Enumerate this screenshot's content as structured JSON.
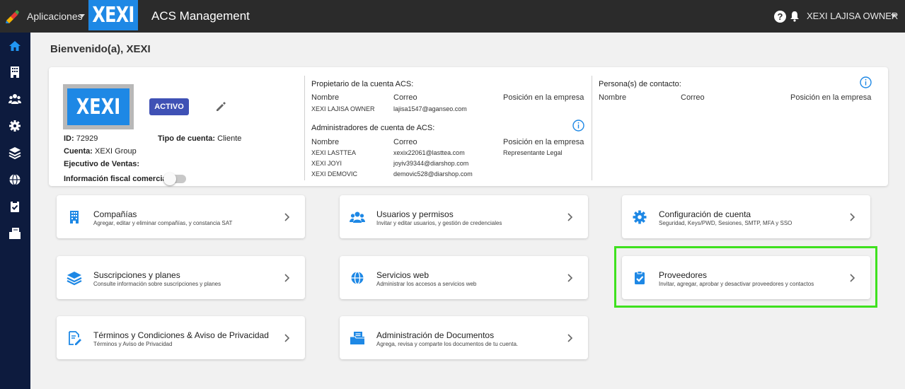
{
  "topbar": {
    "apps_label": "Aplicaciones",
    "logo_text": "XEXI",
    "app_title": "ACS Management",
    "help_label": "?",
    "user_label": "XEXI LAJISA OWNER"
  },
  "sidebar": {
    "items": [
      {
        "name": "home-icon",
        "active": true
      },
      {
        "name": "building-icon"
      },
      {
        "name": "users-icon"
      },
      {
        "name": "gear-icon"
      },
      {
        "name": "layers-icon"
      },
      {
        "name": "globe-icon"
      },
      {
        "name": "clipboard-check-icon"
      },
      {
        "name": "documents-icon"
      }
    ]
  },
  "welcome": "Bienvenido(a), XEXI",
  "account": {
    "logo_text": "XEXI",
    "status": "ACTIVO",
    "id_label": "ID:",
    "id_value": "72929",
    "tipo_label": "Tipo de cuenta:",
    "tipo_value": "Cliente",
    "cuenta_label": "Cuenta:",
    "cuenta_value": "XEXI Group",
    "ejecutivo_label": "Ejecutivo de Ventas:",
    "fiscal_label": "Información fiscal comercial:",
    "owner_section": {
      "title": "Propietario de la cuenta ACS:",
      "headers": [
        "Nombre",
        "Correo",
        "Posición en la empresa"
      ],
      "rows": [
        {
          "nombre": "XEXI LAJISA OWNER",
          "correo": "lajisa1547@aganseo.com",
          "posicion": ""
        }
      ]
    },
    "admins_section": {
      "title": "Administradores de cuenta de ACS:",
      "headers": [
        "Nombre",
        "Correo",
        "Posición en la empresa"
      ],
      "rows": [
        {
          "nombre": "XEXI LASTTEA",
          "correo": "xexix22061@lasttea.com",
          "posicion": "Representante Legal"
        },
        {
          "nombre": "XEXI JOYI",
          "correo": "joyiv39344@diarshop.com",
          "posicion": ""
        },
        {
          "nombre": "XEXI DEMOVIC",
          "correo": "demovic528@diarshop.com",
          "posicion": ""
        }
      ]
    },
    "contacts_section": {
      "title": "Persona(s) de contacto:",
      "headers": [
        "Nombre",
        "Correo",
        "Posición en la empresa"
      ]
    }
  },
  "tiles": [
    {
      "title": "Compañías",
      "subtitle": "Agregar, editar y eliminar compañías, y constancia SAT",
      "icon": "building-icon"
    },
    {
      "title": "Usuarios y permisos",
      "subtitle": "Invitar y editar usuarios, y gestión de credenciales",
      "icon": "users-icon"
    },
    {
      "title": "Configuración de cuenta",
      "subtitle": "Seguridad, Keys/PWD, Sesiones, SMTP, MFA y SSO",
      "icon": "gear-icon"
    },
    {
      "title": "Suscripciones y planes",
      "subtitle": "Consulte información sobre suscripciones y planes",
      "icon": "layers-icon"
    },
    {
      "title": "Servicios web",
      "subtitle": "Administrar los accesos a servicios web",
      "icon": "globe-icon"
    },
    {
      "title": "Proveedores",
      "subtitle": "Invitar, agregar, aprobar y desactivar proveedores y contactos",
      "icon": "clipboard-check-icon"
    },
    {
      "title": "Términos y Condiciones & Aviso de Privacidad",
      "subtitle": "Términos y Aviso de Privacidad",
      "icon": "document-edit-icon"
    },
    {
      "title": "Administración de Documentos",
      "subtitle": "Agrega, revisa y comparte los documentos de tu cuenta.",
      "icon": "documents-icon"
    }
  ],
  "colors": {
    "topbar_bg": "#2b2b2b",
    "sidebar_bg": "#0d1b3e",
    "accent_blue": "#1e88e5",
    "status_btn": "#3f51b5",
    "highlight": "#3fe11f"
  }
}
